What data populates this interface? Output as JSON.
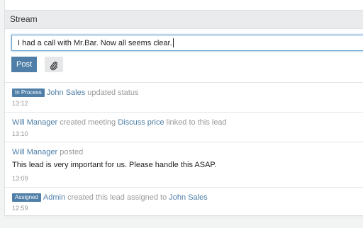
{
  "panel": {
    "title": "Stream"
  },
  "composer": {
    "input_value": "I had a call with Mr.Bar. Now all seems clear.",
    "post_label": "Post",
    "attach_icon": "paperclip-icon"
  },
  "entries": [
    {
      "badge": "In Process",
      "actor": "John Sales",
      "action": "updated status",
      "time": "13:12"
    },
    {
      "actor": "Will Manager",
      "action": "created meeting",
      "target": "Discuss price",
      "suffix": "linked to this lead",
      "time": "13:10"
    },
    {
      "actor": "Will Manager",
      "action": "posted",
      "body": "This lead is very important for us. Please handle this ASAP.",
      "time": "13:09"
    },
    {
      "badge": "Assigned",
      "actor": "Admin",
      "action": "created this lead assigned to",
      "target": "John Sales",
      "time": "12:59"
    }
  ],
  "colors": {
    "accent": "#4f7fa8",
    "heading_bg": "#e9ebec",
    "page_bg": "#f2f3f3",
    "muted_text": "#999999"
  }
}
